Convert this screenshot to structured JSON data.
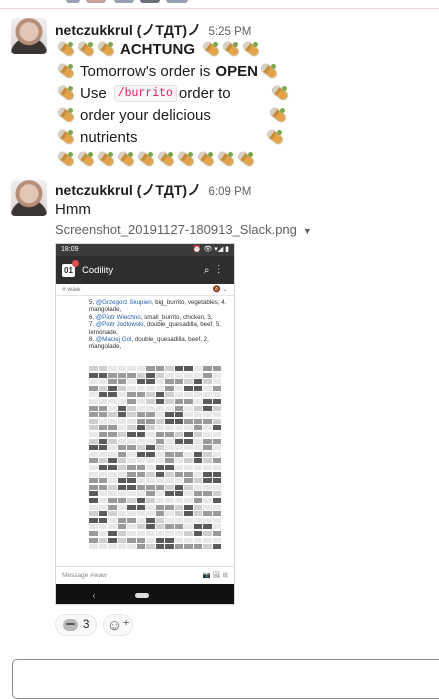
{
  "messages": [
    {
      "author": "netczukkrul (ノTДT)ノ",
      "time": "5:25 PM",
      "lines": {
        "achtung": "ACHTUNG",
        "order_a": "Tomorrow's order is",
        "order_b": "OPEN",
        "use": "Use",
        "command": "/burrito",
        "order_to": "order to",
        "order_your": "order your delicious",
        "nutrients": "nutrients"
      },
      "emoji": "burrito"
    },
    {
      "author": "netczukkrul (ノTДT)ノ",
      "time": "6:09 PM",
      "text": "Hmm",
      "attachment": {
        "filename": "Screenshot_20191127-180913_Slack.png",
        "caret_icon": "caret-down-icon",
        "phone": {
          "status_time": "18:09",
          "status_icons": "⏰ 👁 ▾◢ ▮",
          "app_title": "Codility",
          "logo_text": "01",
          "channel": "# waw",
          "channel_icons": "🔕 ⌄",
          "lines": [
            {
              "num": "5.",
              "user": "@Grzegorz Skupien",
              "rest": ", big_burrito, vegetables, 4. mangolade,"
            },
            {
              "num": "6.",
              "user": "@Piotr Wiechno",
              "rest": ", small_burrito, chicken, 3,"
            },
            {
              "num": "7.",
              "user": "@Piotr Jodlowski",
              "rest": ", double_quesadilla, beef, 5, lemonade,"
            },
            {
              "num": "8.",
              "user": "@Maciej Gol",
              "rest": ", double_quesadilla, beef, 2, mangolade,"
            }
          ],
          "input_placeholder": "Message #waw",
          "input_icons": "📷 🖼 ⊞",
          "nav_back": "‹"
        }
      },
      "reactions": [
        {
          "emoji": "facepalm",
          "count": "3"
        }
      ],
      "add_reaction_icon": "add-reaction-icon"
    }
  ],
  "colors": {
    "command": "#e01e5a",
    "link": "#1f5fa8",
    "phone_bar": "#2e2e2e"
  }
}
